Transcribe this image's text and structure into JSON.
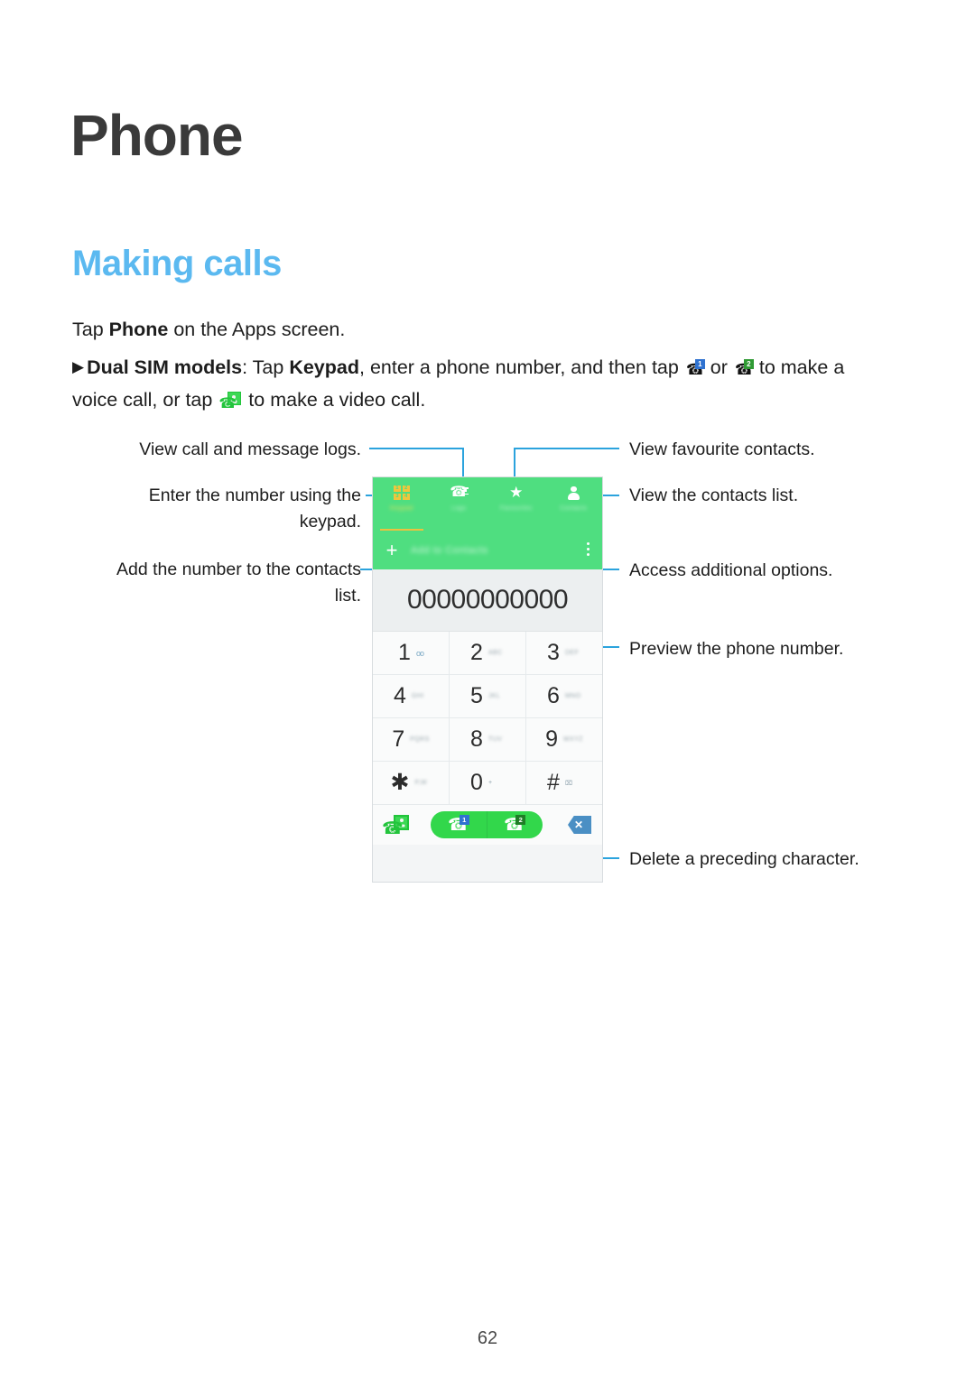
{
  "document": {
    "page_title": "Phone",
    "section_title": "Making calls",
    "page_number": "62"
  },
  "body": {
    "para1": {
      "pre": "Tap ",
      "bold": "Phone",
      "post": " on the Apps screen."
    },
    "para2": {
      "triangle": "▶",
      "bold1": "Dual SIM models",
      "mid1": ": Tap ",
      "bold2": "Keypad",
      "mid2": ", enter a phone number, and then tap ",
      "icon_call_sim1": "call-sim1-icon",
      "mid3": " or ",
      "icon_call_sim2": "call-sim2-icon",
      "mid4": " to make a voice call, or tap ",
      "icon_video_call": "video-call-icon",
      "end": " to make a video call."
    }
  },
  "annotations": {
    "left": [
      {
        "text": "View call and message logs.",
        "target": "logs-tab"
      },
      {
        "text": "Enter the number using the\nkeypad.",
        "target": "keypad-tab"
      },
      {
        "text": "Add the number to the contacts\nlist.",
        "target": "add-to-contacts-button"
      }
    ],
    "right": [
      {
        "text": "View favourite contacts.",
        "target": "favourites-tab"
      },
      {
        "text": "View the contacts list.",
        "target": "contacts-tab"
      },
      {
        "text": "Access additional options.",
        "target": "more-options-button"
      },
      {
        "text": "Preview the phone number.",
        "target": "number-display"
      },
      {
        "text": "Delete a preceding character.",
        "target": "backspace-button"
      }
    ]
  },
  "device": {
    "tabs": [
      {
        "label": "Keypad",
        "icon": "keypad-grid-icon",
        "active": true
      },
      {
        "label": "Logs",
        "icon": "call-logs-icon",
        "active": false
      },
      {
        "label": "Favourites",
        "icon": "star-icon",
        "active": false
      },
      {
        "label": "Contacts",
        "icon": "person-icon",
        "active": false
      }
    ],
    "keypad_icon_digits": [
      "1",
      "2",
      "3",
      "4"
    ],
    "add_row": {
      "plus": "+",
      "label": "Add to Contacts",
      "more_icon": "overflow-menu-icon"
    },
    "number_display": "00000000000",
    "keys": [
      {
        "digit": "1",
        "sub": "∞",
        "sub_kind": "voicemail"
      },
      {
        "digit": "2",
        "sub": "ABC",
        "sub_kind": "letters"
      },
      {
        "digit": "3",
        "sub": "DEF",
        "sub_kind": "letters"
      },
      {
        "digit": "4",
        "sub": "GHI",
        "sub_kind": "letters"
      },
      {
        "digit": "5",
        "sub": "JKL",
        "sub_kind": "letters"
      },
      {
        "digit": "6",
        "sub": "MNO",
        "sub_kind": "letters"
      },
      {
        "digit": "7",
        "sub": "PQRS",
        "sub_kind": "letters"
      },
      {
        "digit": "8",
        "sub": "TUV",
        "sub_kind": "letters"
      },
      {
        "digit": "9",
        "sub": "WXYZ",
        "sub_kind": "letters"
      },
      {
        "digit": "✱",
        "sub": "P,W",
        "sub_kind": "letters"
      },
      {
        "digit": "0",
        "sub": "+",
        "sub_kind": "plus"
      },
      {
        "digit": "#",
        "sub": "⌧",
        "sub_kind": "symbol"
      }
    ],
    "call_bar": {
      "video_call": "video-call-button",
      "sim1_badge": "1",
      "sim2_badge": "2",
      "backspace": "backspace-button"
    }
  },
  "colors": {
    "heading_blue": "#5bb9f0",
    "app_green": "#4fde80",
    "dial_green": "#32d74b",
    "leader_blue": "#2ba3dd",
    "tab_underline_gold": "#ecc23f",
    "badge_sim1_blue": "#2f72d0",
    "badge_sim2_green": "#1f7d26"
  }
}
